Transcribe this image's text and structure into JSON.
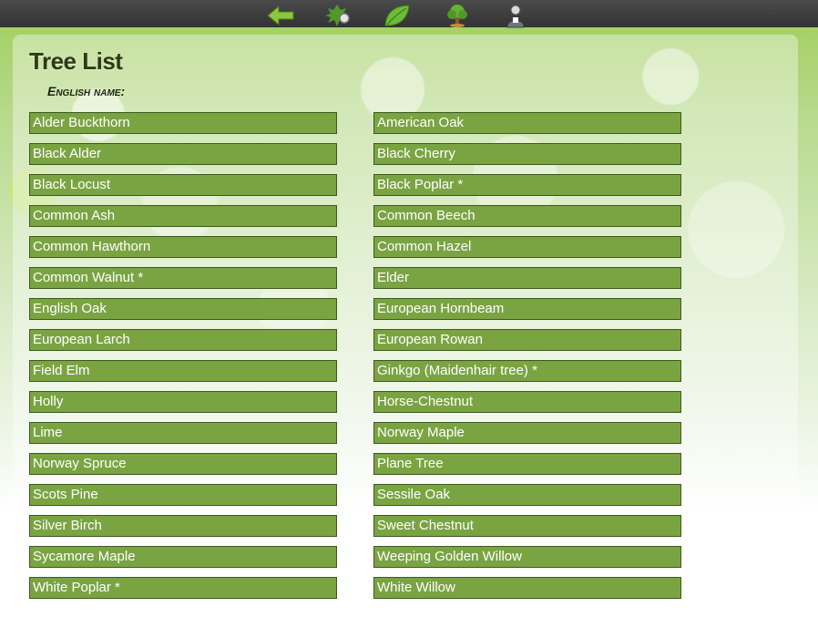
{
  "nav": {
    "icons": [
      "back-arrow-icon",
      "tree-search-icon",
      "leaf-icon",
      "tree-icon",
      "user-icon"
    ]
  },
  "page": {
    "title": "Tree List",
    "subheading": "English name:"
  },
  "trees": [
    "Alder Buckthorn",
    "American Oak",
    "Black Alder",
    "Black Cherry",
    "Black Locust",
    "Black Poplar *",
    "Common Ash",
    "Common Beech",
    "Common Hawthorn",
    "Common Hazel",
    "Common Walnut *",
    "Elder",
    "English Oak",
    "European Hornbeam",
    "European Larch",
    "European Rowan",
    "Field Elm",
    "Ginkgo (Maidenhair tree) *",
    "Holly",
    "Horse-Chestnut",
    "Lime",
    "Norway Maple",
    "Norway Spruce",
    "Plane Tree",
    "Scots Pine",
    "Sessile Oak",
    "Silver Birch",
    "Sweet Chestnut",
    "Sycamore Maple",
    "Weeping Golden Willow",
    "White Poplar *",
    "White Willow"
  ]
}
